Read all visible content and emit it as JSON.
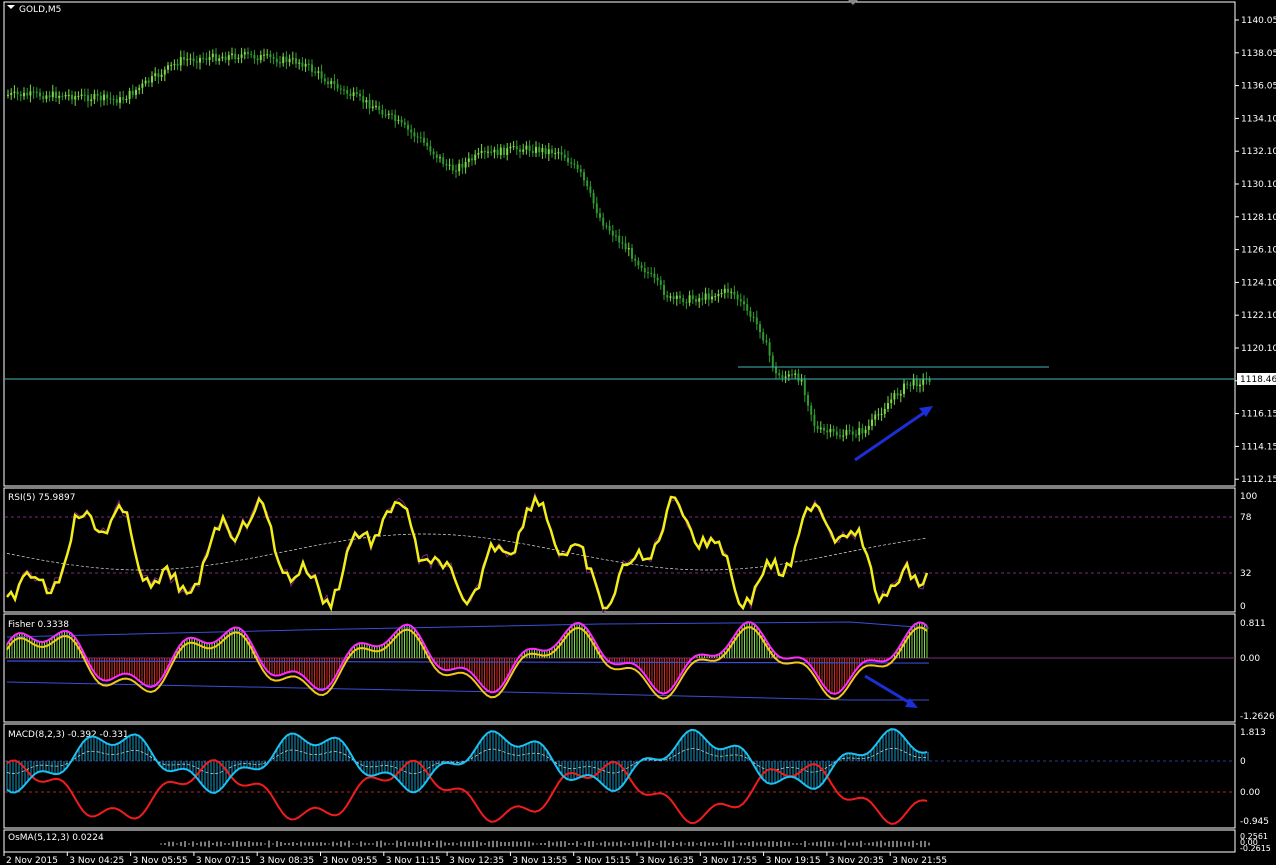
{
  "colors": {
    "background": "#000000",
    "frame": "#ffffff",
    "bull_candle": "#7dd94a",
    "bear_candle": "#2f9a2f",
    "hline": "#46b6b6",
    "arrow": "#1c2fd6",
    "rsi_line": "#f2ee1b",
    "rsi_signal": "#7a2a7a",
    "fisher_fast": "#ff2cff",
    "fisher_slow": "#f2c81b",
    "fisher_band": "#3a4fd6",
    "fisher_hist_up": "#7dd94a",
    "fisher_hist_down": "#cc2c20",
    "macd_up": "#1cc0f2",
    "macd_down": "#f21c1c",
    "osma": "#7a7a7a",
    "level_dash": "#7a2a7a"
  },
  "main": {
    "symbol_label": "GOLD,M5",
    "price_ticks": [
      "1140.05",
      "1138.05",
      "1136.05",
      "1134.10",
      "1132.10",
      "1130.10",
      "1128.10",
      "1126.10",
      "1124.10",
      "1122.10",
      "1120.10",
      "1118.15",
      "1116.15",
      "1114.15",
      "1112.15"
    ],
    "current_price": "1118.46"
  },
  "rsi": {
    "label": "RSI(5) 75.9897",
    "ticks": [
      "100",
      "78",
      "32",
      "0"
    ]
  },
  "fisher": {
    "label": "Fisher 0.3338",
    "ticks": [
      "0.811",
      "0.00",
      "-1.2626"
    ]
  },
  "macd": {
    "label": "MACD(8,2,3) -0.392 -0.331",
    "ticks": [
      "1.813",
      "0",
      "0.00",
      "-0.945"
    ]
  },
  "osma": {
    "label": "OsMA(5,12,3) 0.0224",
    "ticks": [
      "0.2561",
      "0.00",
      "-0.2615"
    ]
  },
  "time_axis": [
    "2 Nov 2015",
    "3 Nov 04:25",
    "3 Nov 05:55",
    "3 Nov 07:15",
    "3 Nov 08:35",
    "3 Nov 09:55",
    "3 Nov 11:15",
    "3 Nov 12:35",
    "3 Nov 13:55",
    "3 Nov 15:15",
    "3 Nov 16:35",
    "3 Nov 17:55",
    "3 Nov 19:15",
    "3 Nov 20:35",
    "3 Nov 21:55"
  ]
}
